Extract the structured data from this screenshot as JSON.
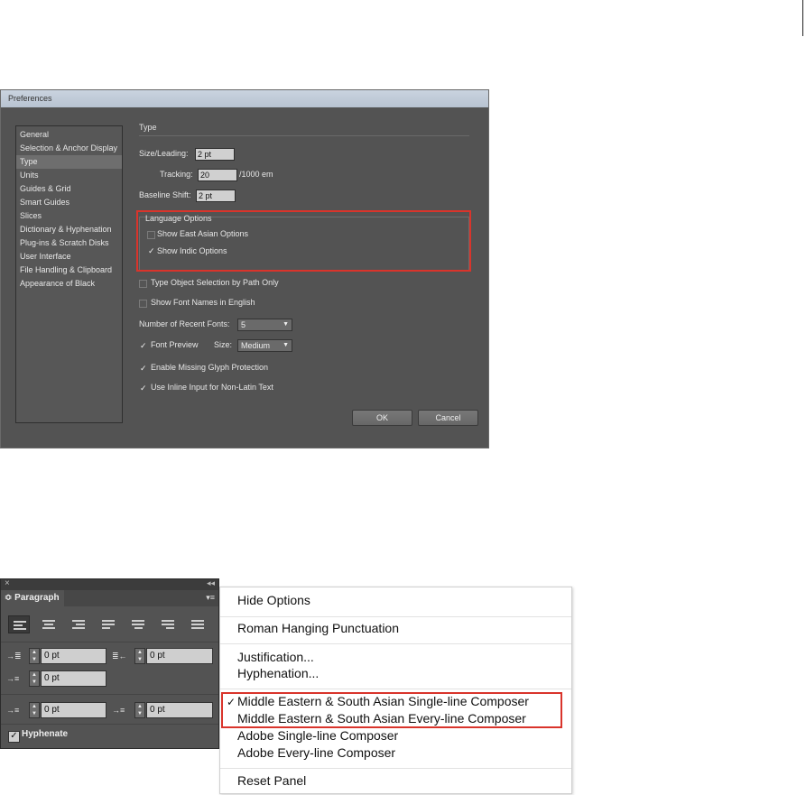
{
  "preferences": {
    "title": "Preferences",
    "categories": [
      "General",
      "Selection & Anchor Display",
      "Type",
      "Units",
      "Guides & Grid",
      "Smart Guides",
      "Slices",
      "Dictionary & Hyphenation",
      "Plug-ins & Scratch Disks",
      "User Interface",
      "File Handling & Clipboard",
      "Appearance of Black"
    ],
    "selected_category": "Type",
    "section_title": "Type",
    "size_leading": {
      "label": "Size/Leading:",
      "value": "2 pt"
    },
    "tracking": {
      "label": "Tracking:",
      "value": "20",
      "unit": "/1000 em"
    },
    "baseline_shift": {
      "label": "Baseline Shift:",
      "value": "2 pt"
    },
    "language_options": {
      "label": "Language Options",
      "show_east_asian": {
        "label": "Show East Asian Options",
        "checked": false
      },
      "show_indic": {
        "label": "Show Indic Options",
        "checked": true
      }
    },
    "type_object_selection": {
      "label": "Type Object Selection by Path Only",
      "checked": false
    },
    "show_font_names_english": {
      "label": "Show Font Names in English",
      "checked": false
    },
    "recent_fonts": {
      "label": "Number of Recent Fonts:",
      "value": "5"
    },
    "font_preview": {
      "label": "Font Preview",
      "checked": true,
      "size_label": "Size:",
      "size_value": "Medium"
    },
    "missing_glyph": {
      "label": "Enable Missing Glyph Protection",
      "checked": true
    },
    "inline_input": {
      "label": "Use Inline Input for Non-Latin Text",
      "checked": true
    },
    "ok_label": "OK",
    "cancel_label": "Cancel",
    "check_glyph": "✓"
  },
  "paragraph_panel": {
    "tab_label": "Paragraph",
    "tab_prefix": "≎",
    "close_glyph": "×",
    "collapse_glyph": "◂◂",
    "menu_glyph": "▾≡",
    "left_indent": "0 pt",
    "right_indent": "0 pt",
    "first_line_indent": "0 pt",
    "space_before": "0 pt",
    "space_after": "0 pt",
    "hyphenate": {
      "label": "Hyphenate",
      "checked": true,
      "glyph": "✓"
    },
    "spin_up": "▲",
    "spin_down": "▼",
    "icons": {
      "left_indent": "→≣",
      "right_indent": "≣←",
      "first_line": "→≡",
      "space_before": "→≡",
      "space_after": "→≡"
    }
  },
  "flyout_menu": {
    "items": {
      "hide_options": "Hide Options",
      "roman_hanging": "Roman Hanging Punctuation",
      "justification": "Justification...",
      "hyphenation": "Hyphenation...",
      "me_single": "Middle Eastern & South Asian Single-line Composer",
      "me_every": "Middle Eastern & South Asian Every-line Composer",
      "adobe_single": "Adobe Single-line Composer",
      "adobe_every": "Adobe Every-line Composer",
      "reset_panel": "Reset Panel"
    },
    "checked_item": "Middle Eastern & South Asian Single-line Composer",
    "check_glyph": "✓"
  }
}
